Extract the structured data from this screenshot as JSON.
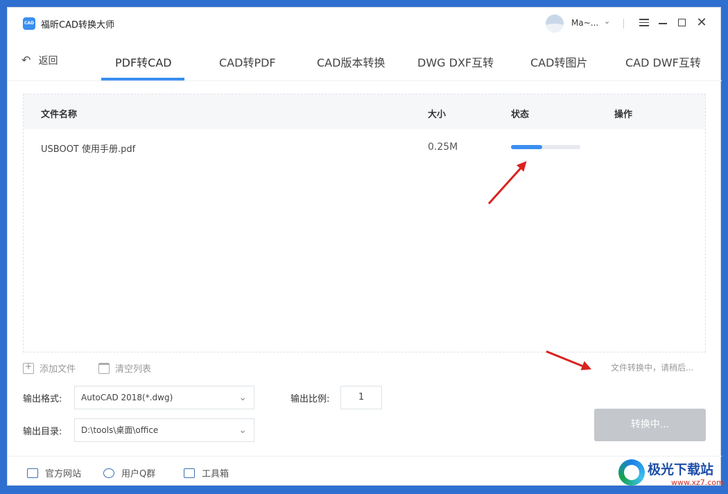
{
  "app": {
    "title": "福昕CAD转换大师",
    "logo_text": "CAD"
  },
  "user": {
    "name": "Ma~..."
  },
  "nav": {
    "back_label": "返回",
    "tabs": [
      "PDF转CAD",
      "CAD转PDF",
      "CAD版本转换",
      "DWG DXF互转",
      "CAD转图片",
      "CAD DWF互转"
    ],
    "active_tab": "PDF转CAD"
  },
  "table": {
    "headers": {
      "name": "文件名称",
      "size": "大小",
      "status": "状态",
      "action": "操作"
    },
    "rows": [
      {
        "name": "USBOOT 使用手册.pdf",
        "size": "0.25M",
        "progress": 0.45
      }
    ]
  },
  "actions": {
    "add_file": "添加文件",
    "clear_list": "清空列表"
  },
  "status_message": "文件转换中，请稍后...",
  "settings": {
    "format_label": "输出格式:",
    "format_value": "AutoCAD 2018(*.dwg)",
    "dir_label": "输出目录:",
    "dir_value": "D:\\tools\\桌面\\office",
    "scale_label": "输出比例:",
    "scale_value": "1"
  },
  "convert_button": "转换中...",
  "footer": {
    "website": "官方网站",
    "qq_group": "用户Q群",
    "toolbox": "工具箱"
  },
  "watermark": {
    "text": "极光下载站",
    "url": "www.xz7.com"
  },
  "colors": {
    "accent": "#3a8ff0",
    "arrow": "#d8231f",
    "disabled_button": "#c4c7cc"
  }
}
